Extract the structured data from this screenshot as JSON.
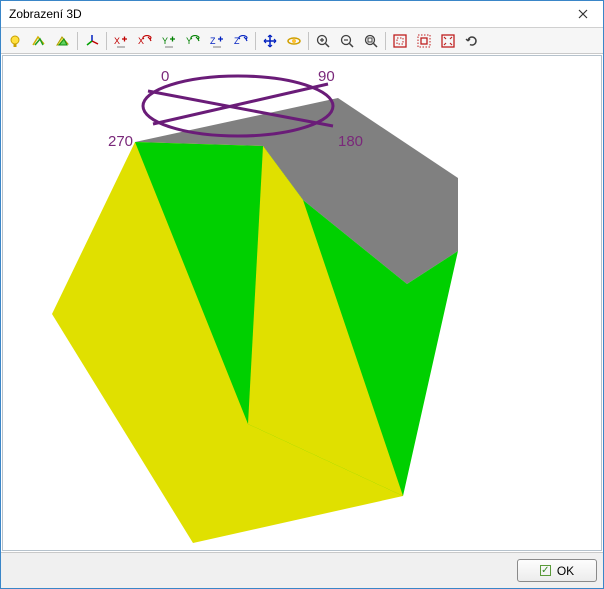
{
  "window": {
    "title": "Zobrazení 3D"
  },
  "toolbar": {
    "items": [
      "light-bulb",
      "wireframe-1",
      "wireframe-2",
      "sep",
      "axes",
      "sep",
      "x-plus",
      "x-rotate",
      "y-plus",
      "y-rotate",
      "z-plus",
      "z-rotate",
      "sep",
      "pan",
      "orbit",
      "sep",
      "zoom-in",
      "zoom-out",
      "zoom-extents",
      "sep",
      "region-outer",
      "region-inner",
      "fit-window",
      "refresh"
    ]
  },
  "compass": {
    "n": "0",
    "e": "90",
    "s": "180",
    "w": "270"
  },
  "viewport": {
    "surfaces": [
      {
        "name": "gray-top-face",
        "color": "#808080"
      },
      {
        "name": "green-front-face",
        "color": "#00d000"
      },
      {
        "name": "yellow-side-face",
        "color": "#e0e000"
      }
    ]
  },
  "footer": {
    "ok_label": "OK"
  }
}
